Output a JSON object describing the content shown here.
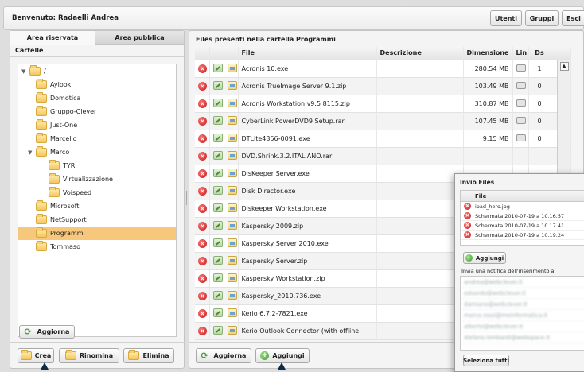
{
  "header": {
    "welcome": "Benvenuto: Radaelli Andrea",
    "buttons": [
      "Utenti",
      "Gruppi",
      "Esci"
    ]
  },
  "left": {
    "tabs": [
      "Area riservata",
      "Area pubblica"
    ],
    "section_title": "Cartelle",
    "tree": [
      {
        "label": "/",
        "expanded": true
      },
      {
        "label": "Aylook"
      },
      {
        "label": "Domotica"
      },
      {
        "label": "Gruppo-Clever"
      },
      {
        "label": "Just-One"
      },
      {
        "label": "Marcello"
      },
      {
        "label": "Marco",
        "expanded": true
      },
      {
        "label": "TYR"
      },
      {
        "label": "Virtualizzazione"
      },
      {
        "label": "Voispeed"
      },
      {
        "label": "Microsoft"
      },
      {
        "label": "NetSupport"
      },
      {
        "label": "Programmi",
        "selected": true
      },
      {
        "label": "Tommaso"
      }
    ],
    "refresh_label": "Aggiorna",
    "bottom_buttons": [
      "Crea",
      "Rinomina",
      "Elimina"
    ]
  },
  "files": {
    "title": "Files presenti nella cartella Programmi",
    "columns": [
      "File",
      "Descrizione",
      "Dimensione",
      "Lin",
      "Ds"
    ],
    "rows": [
      {
        "file": "Acronis 10.exe",
        "desc": "",
        "size": "280.54 MB",
        "ds": "1"
      },
      {
        "file": "Acronis TrueImage Server 9.1.zip",
        "desc": "",
        "size": "103.49 MB",
        "ds": "0"
      },
      {
        "file": "Acronis Workstation v9.5 8115.zip",
        "desc": "",
        "size": "310.87 MB",
        "ds": "0"
      },
      {
        "file": "CyberLink PowerDVD9 Setup.rar",
        "desc": "",
        "size": "107.45 MB",
        "ds": "0"
      },
      {
        "file": "DTLite4356-0091.exe",
        "desc": "",
        "size": "9.15 MB",
        "ds": "0"
      },
      {
        "file": "DVD.Shrink.3.2.ITALIANO.rar",
        "desc": "",
        "size": "",
        "ds": ""
      },
      {
        "file": "DisKeeper Server.exe",
        "desc": "",
        "size": "",
        "ds": ""
      },
      {
        "file": "Disk Director.exe",
        "desc": "",
        "size": "",
        "ds": ""
      },
      {
        "file": "Diskeeper Workstation.exe",
        "desc": "",
        "size": "",
        "ds": ""
      },
      {
        "file": "Kaspersky 2009.zip",
        "desc": "",
        "size": "",
        "ds": ""
      },
      {
        "file": "Kaspersky Server 2010.exe",
        "desc": "",
        "size": "",
        "ds": ""
      },
      {
        "file": "Kaspersky Server.zip",
        "desc": "",
        "size": "",
        "ds": ""
      },
      {
        "file": "Kaspersky Workstation.zip",
        "desc": "",
        "size": "",
        "ds": ""
      },
      {
        "file": "Kaspersky_2010.736.exe",
        "desc": "",
        "size": "",
        "ds": ""
      },
      {
        "file": "Kerio 6.7.2-7821.exe",
        "desc": "",
        "size": "",
        "ds": ""
      },
      {
        "file": "Kerio Outlook Connector (with offline",
        "desc": "",
        "size": "",
        "ds": ""
      }
    ],
    "refresh_label": "Aggiorna",
    "add_label": "Aggiungi"
  },
  "popup": {
    "title": "Invio Files",
    "column": "File",
    "files": [
      "ipad_hero.jpg",
      "Schermata 2010-07-19 a 10.16.57",
      "Schermata 2010-07-19 a 10.17.41",
      "Schermata 2010-07-19 a 10.19.24"
    ],
    "add_label": "Aggiungi",
    "notify_label": "Invia una notifica dell'inserimento a:",
    "emails": [
      "andrea@webclever.it",
      "edoardo@webclever.it",
      "damiano@webclever.it",
      "marco.rossi@meinformatica.it",
      "alberto@webclever.it",
      "stefano.lombardi@webspace.it"
    ],
    "select_all_label": "Seleziona tutti"
  }
}
